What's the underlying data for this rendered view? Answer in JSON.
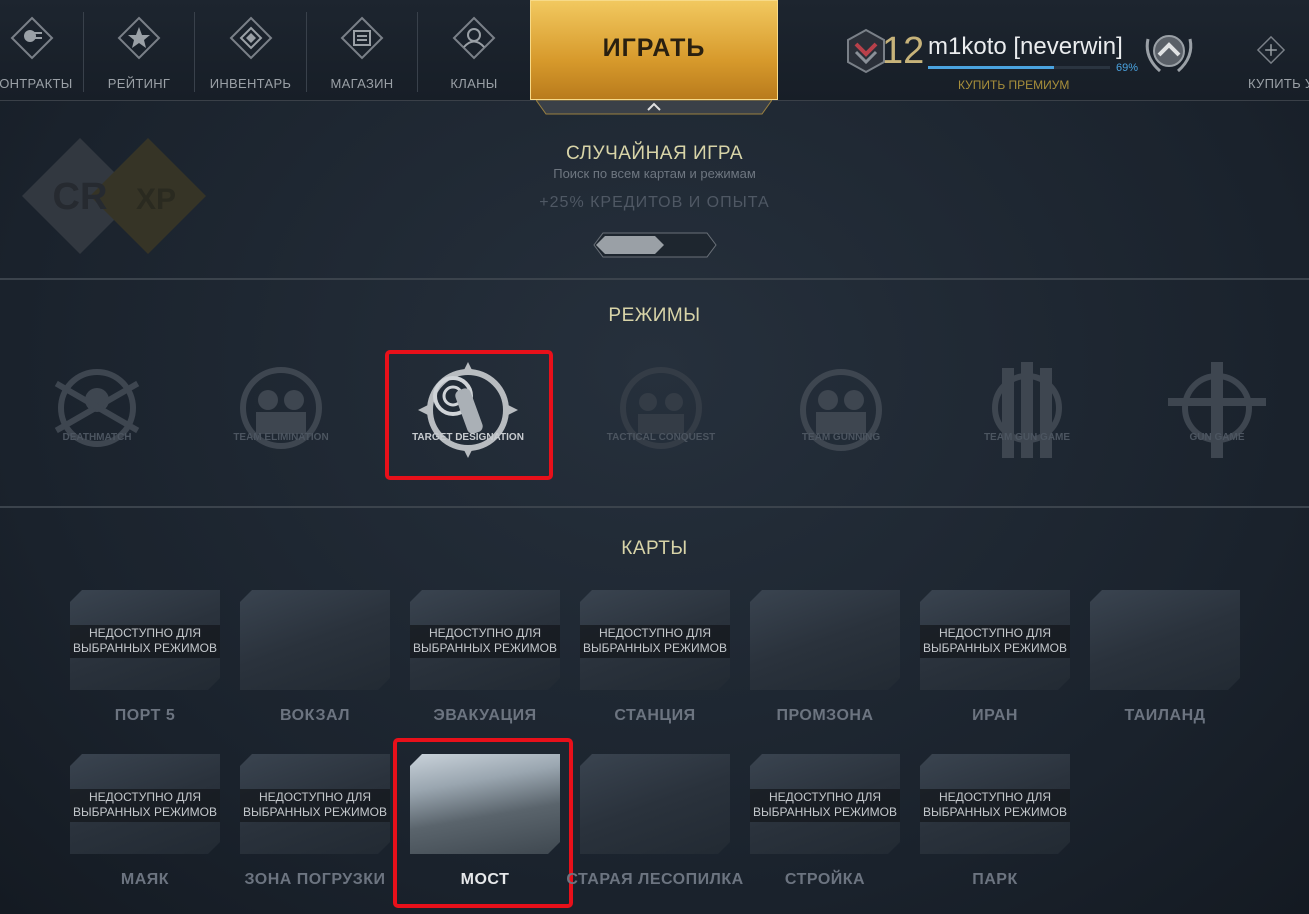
{
  "nav": {
    "items": [
      {
        "label": "КОНТРАКТЫ",
        "icon": "contracts-icon"
      },
      {
        "label": "РЕЙТИНГ",
        "icon": "rating-star-icon"
      },
      {
        "label": "ИНВЕНТАРЬ",
        "icon": "inventory-icon"
      },
      {
        "label": "МАГАЗИН",
        "icon": "shop-icon"
      },
      {
        "label": "КЛАНЫ",
        "icon": "clans-icon"
      }
    ],
    "play_label": "ИГРАТЬ",
    "buy_label": "КУПИТЬ У"
  },
  "profile": {
    "level": "12",
    "nickname": "m1koto [neverwin]",
    "xp_percent_text": "69%",
    "xp_fraction": 0.69,
    "buy_premium": "КУПИТЬ ПРЕМИУМ"
  },
  "random_game": {
    "title": "СЛУЧАЙНАЯ ИГРА",
    "subtitle": "Поиск по всем картам и режимам",
    "bonus": "+25% КРЕДИТОВ И ОПЫТА",
    "badges": [
      "CR",
      "XP"
    ]
  },
  "modes": {
    "title": "РЕЖИМЫ",
    "items": [
      {
        "label": "DEATHMATCH"
      },
      {
        "label": "TEAM ELIMINATION"
      },
      {
        "label": "TARGET DESIGNATION",
        "selected": true
      },
      {
        "label": "TACTICAL CONQUEST"
      },
      {
        "label": "TEAM GUNNING"
      },
      {
        "label": "TEAM GUN GAME"
      },
      {
        "label": "GUN GAME"
      }
    ]
  },
  "maps": {
    "title": "КАРТЫ",
    "unavailable_text_1": "НЕДОСТУПНО ДЛЯ",
    "unavailable_text_2": "ВЫБРАННЫХ РЕЖИМОВ",
    "items": [
      {
        "name": "ПОРТ 5",
        "unavailable": true
      },
      {
        "name": "ВОКЗАЛ",
        "unavailable": false
      },
      {
        "name": "ЭВАКУАЦИЯ",
        "unavailable": true
      },
      {
        "name": "СТАНЦИЯ",
        "unavailable": true
      },
      {
        "name": "ПРОМЗОНА",
        "unavailable": false
      },
      {
        "name": "ИРАН",
        "unavailable": true
      },
      {
        "name": "ТАИЛАНД",
        "unavailable": false
      },
      {
        "name": "МАЯК",
        "unavailable": true
      },
      {
        "name": "ЗОНА ПОГРУЗКИ",
        "unavailable": true
      },
      {
        "name": "МОСТ",
        "unavailable": false,
        "selected": true
      },
      {
        "name": "СТАРАЯ ЛЕСОПИЛКА",
        "unavailable": false
      },
      {
        "name": "СТРОЙКА",
        "unavailable": true
      },
      {
        "name": "ПАРК",
        "unavailable": true
      }
    ]
  },
  "colors": {
    "accent_gold": "#d79a2c",
    "highlight_red": "#e8101a",
    "xp_blue": "#4aa3e0"
  }
}
